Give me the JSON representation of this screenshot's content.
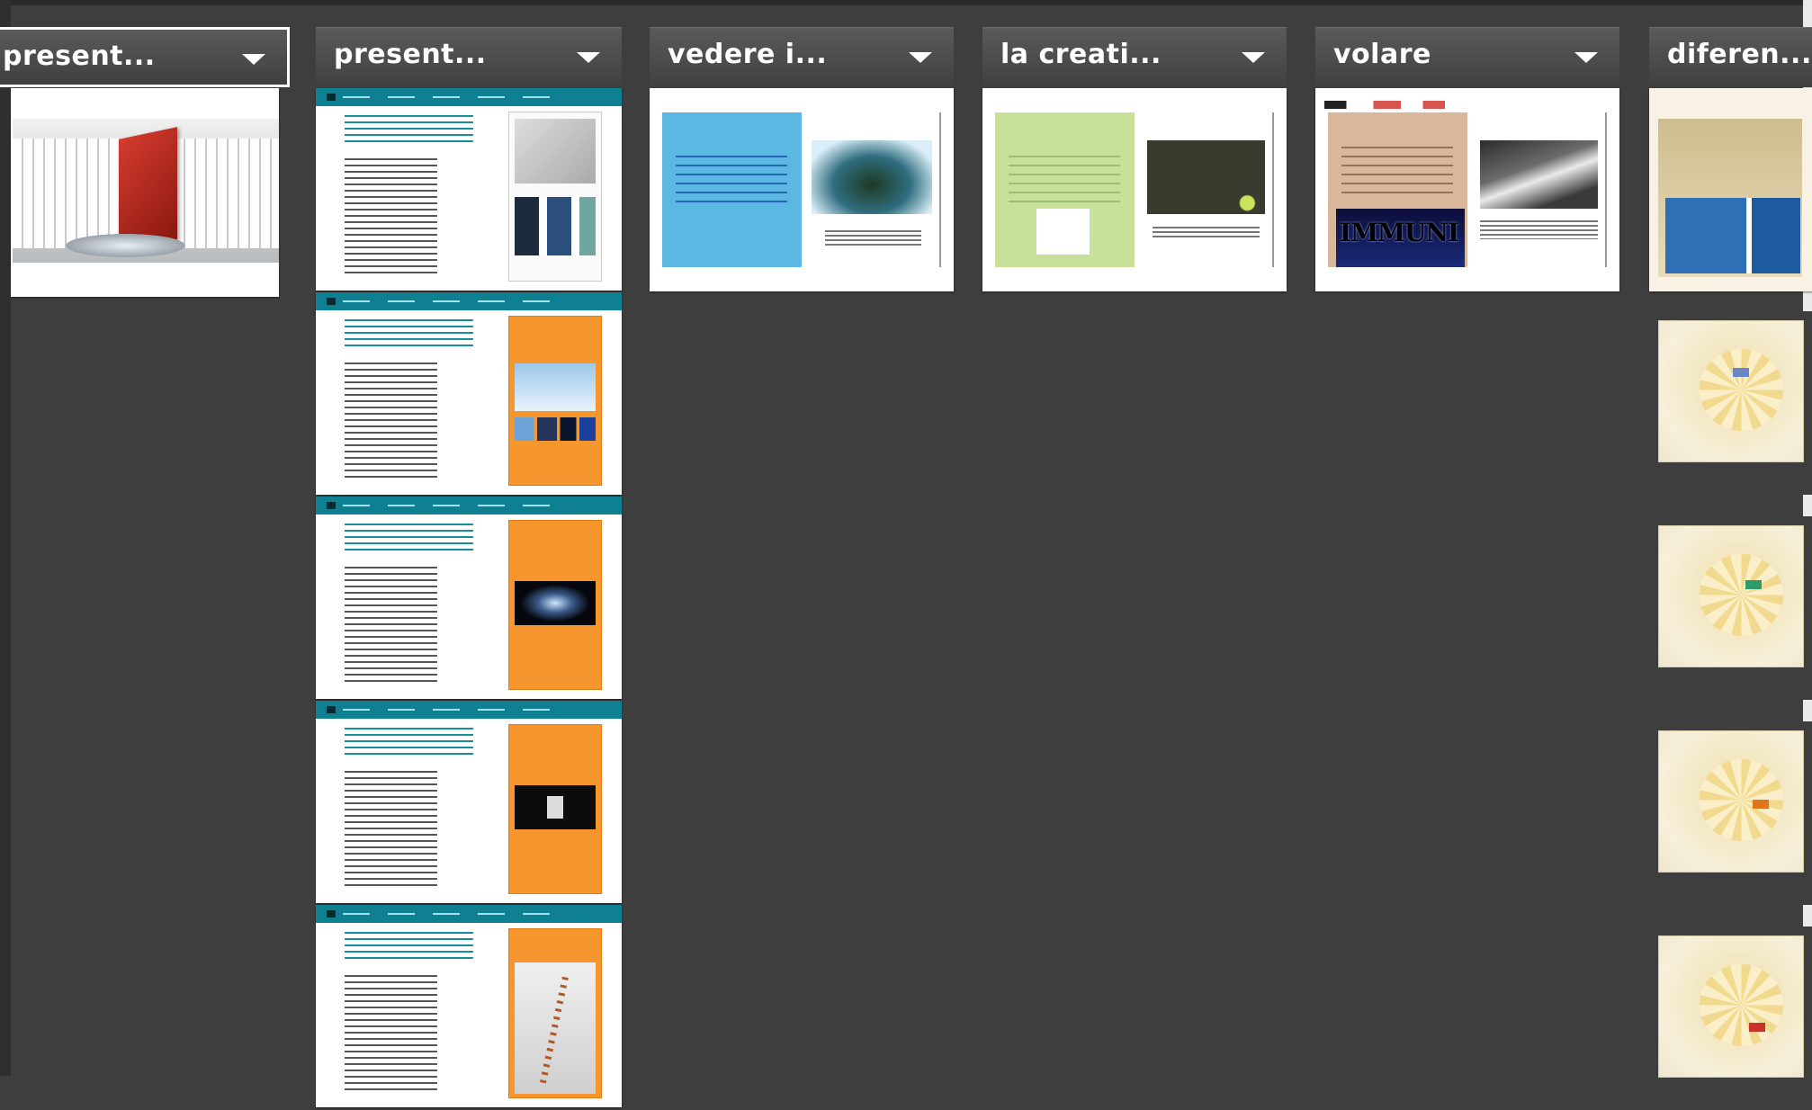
{
  "columns": [
    {
      "title": "present...",
      "selected": true
    },
    {
      "title": "present...",
      "selected": false
    },
    {
      "title": "vedere i...",
      "selected": false
    },
    {
      "title": "la creati...",
      "selected": false
    },
    {
      "title": "volare",
      "selected": false
    },
    {
      "title": "diferen...",
      "selected": false
    }
  ],
  "thumbnail_captions": {
    "volare": "IMMUNI"
  },
  "colors": {
    "background": "#3e3e3e",
    "header": "#4a4a4a",
    "teal": "#0f7f92",
    "orange": "#f5962e",
    "sky_blue": "#5bb8e3",
    "lime": "#c7e09a"
  },
  "icons": [
    "dropdown-caret-icon"
  ]
}
